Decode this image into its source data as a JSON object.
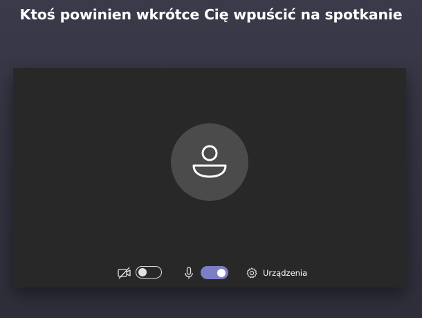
{
  "prejoin": {
    "title": "Ktoś powinien wkrótce Cię wpuścić na spotkanie"
  },
  "preview": {
    "avatar_icon": "person-icon"
  },
  "controls": {
    "camera": {
      "icon": "video-off-icon",
      "enabled": false
    },
    "microphone": {
      "icon": "microphone-icon",
      "enabled": true
    },
    "devices": {
      "icon": "gear-icon",
      "label": "Urządzenia"
    }
  },
  "colors": {
    "accent": "#7b7fc4",
    "stage_background": "#292828",
    "avatar_background": "#4c4b4b"
  }
}
